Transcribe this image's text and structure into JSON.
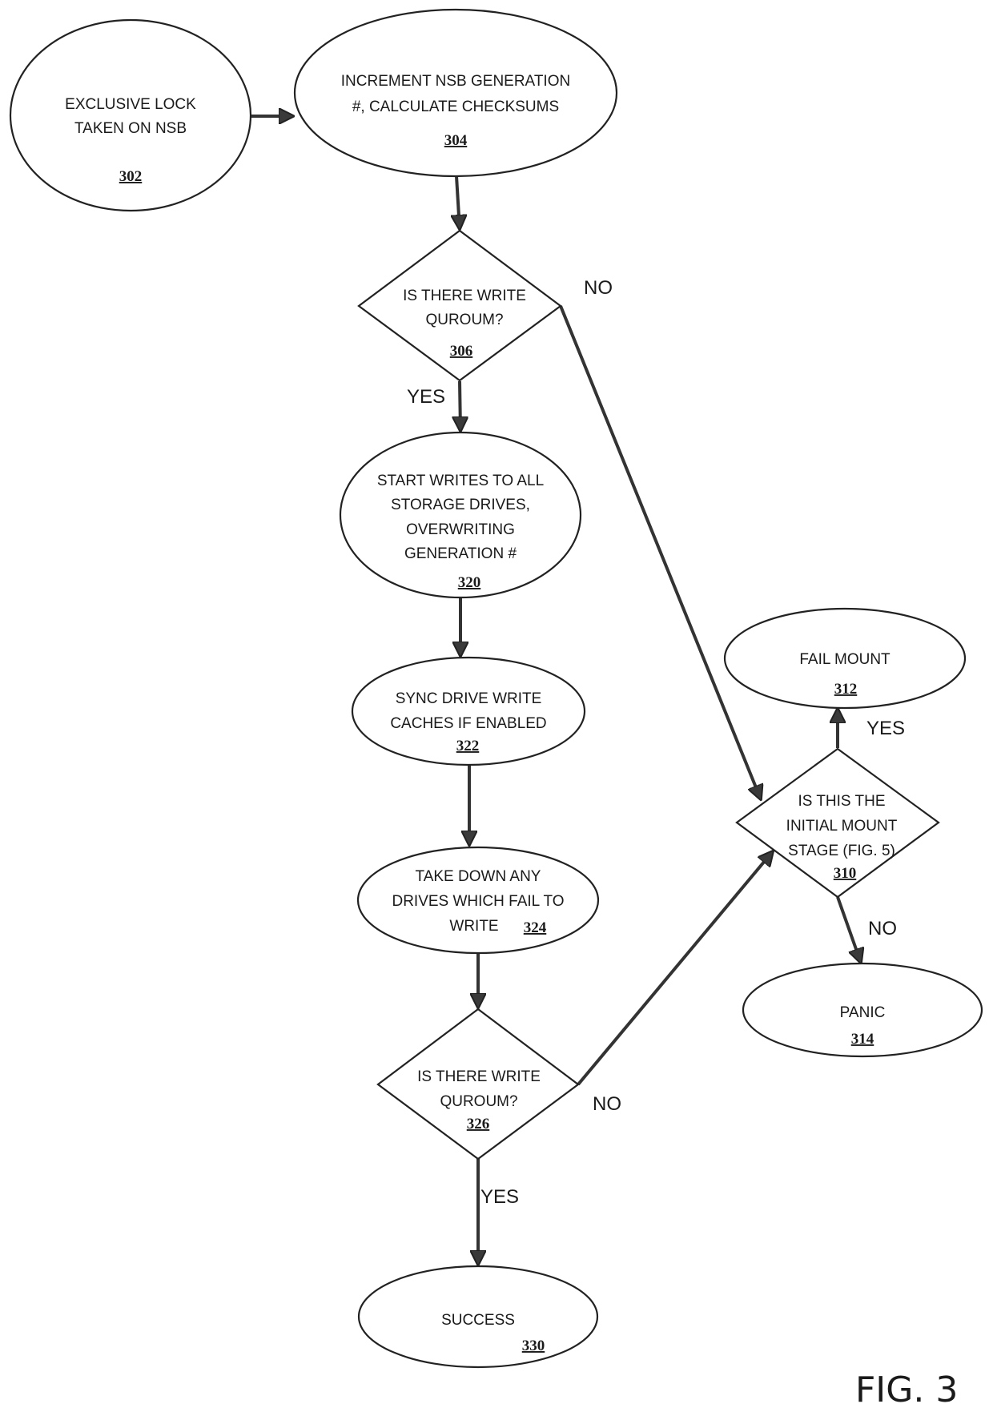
{
  "figure_label": "FIG. 3",
  "nodes": {
    "n302": {
      "shape": "ellipse",
      "lines": [
        "EXCLUSIVE LOCK",
        "TAKEN ON NSB"
      ],
      "ref": "302"
    },
    "n304": {
      "shape": "ellipse",
      "lines": [
        "INCREMENT NSB GENERATION",
        "#, CALCULATE CHECKSUMS"
      ],
      "ref": "304"
    },
    "n306": {
      "shape": "diamond",
      "lines": [
        "IS THERE WRITE",
        "QUROUM?"
      ],
      "ref": "306"
    },
    "n320": {
      "shape": "ellipse",
      "lines": [
        "START WRITES TO ALL",
        "STORAGE DRIVES,",
        "OVERWRITING",
        "GENERATION #"
      ],
      "ref": "320"
    },
    "n322": {
      "shape": "ellipse",
      "lines": [
        "SYNC DRIVE WRITE",
        "CACHES IF ENABLED"
      ],
      "ref": "322"
    },
    "n324": {
      "shape": "ellipse",
      "lines": [
        "TAKE DOWN ANY",
        "DRIVES WHICH FAIL TO",
        "WRITE"
      ],
      "ref": "324"
    },
    "n326": {
      "shape": "diamond",
      "lines": [
        "IS THERE WRITE",
        "QUROUM?"
      ],
      "ref": "326"
    },
    "n330": {
      "shape": "ellipse",
      "lines": [
        "SUCCESS"
      ],
      "ref": "330"
    },
    "n312": {
      "shape": "ellipse",
      "lines": [
        "FAIL MOUNT"
      ],
      "ref": "312"
    },
    "n310": {
      "shape": "diamond",
      "lines": [
        "IS THIS THE",
        "INITIAL MOUNT",
        "STAGE (FIG. 5)"
      ],
      "ref": "310"
    },
    "n314": {
      "shape": "ellipse",
      "lines": [
        "PANIC"
      ],
      "ref": "314"
    }
  },
  "edges": [
    {
      "from": "302",
      "to": "304",
      "label": ""
    },
    {
      "from": "304",
      "to": "306",
      "label": ""
    },
    {
      "from": "306",
      "to": "320",
      "label": "YES"
    },
    {
      "from": "306",
      "to": "310",
      "label": "NO"
    },
    {
      "from": "320",
      "to": "322",
      "label": ""
    },
    {
      "from": "322",
      "to": "324",
      "label": ""
    },
    {
      "from": "324",
      "to": "326",
      "label": ""
    },
    {
      "from": "326",
      "to": "330",
      "label": "YES"
    },
    {
      "from": "326",
      "to": "310",
      "label": "NO"
    },
    {
      "from": "310",
      "to": "312",
      "label": "YES"
    },
    {
      "from": "310",
      "to": "314",
      "label": "NO"
    }
  ]
}
